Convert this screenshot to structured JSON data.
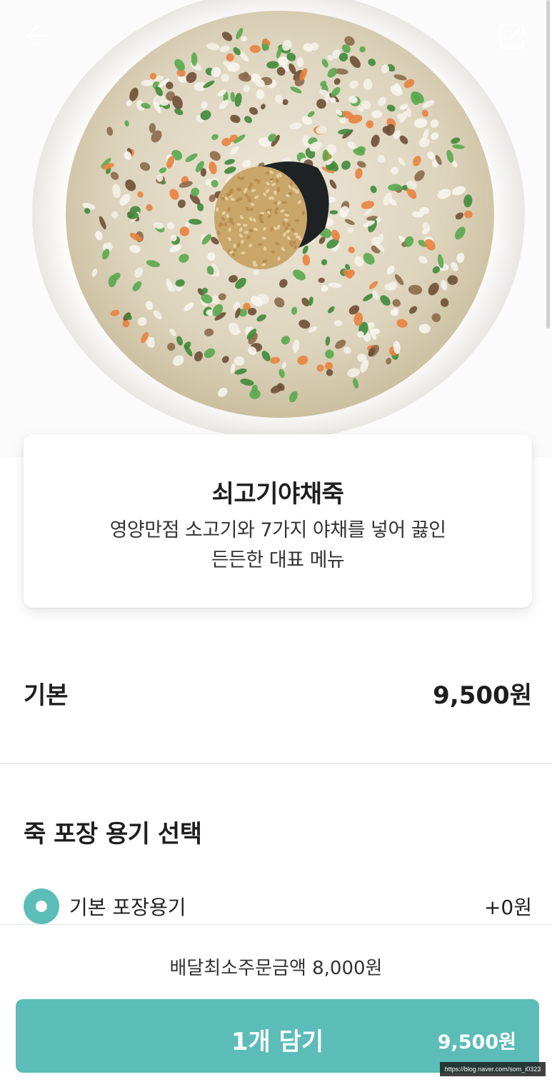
{
  "menu": {
    "title": "쇠고기야채죽",
    "description_line1": "영양만점 소고기와 7가지 야채를 넣어 끓인",
    "description_line2": "든든한 대표 메뉴"
  },
  "base": {
    "label": "기본",
    "price": "9,500원"
  },
  "packaging": {
    "title": "죽 포장 용기 선택",
    "options": [
      {
        "label": "기본 포장용기",
        "price": "+0원",
        "selected": true
      }
    ]
  },
  "order": {
    "min_order_text": "배달최소주문금액 8,000원",
    "button_label": "1개 담기",
    "button_price": "9,500원"
  },
  "watermark": "https://blog.naver.com/som_i0323",
  "icons": {
    "back": "arrow-left-icon",
    "share": "share-icon",
    "radio": "radio-selected-icon"
  },
  "colors": {
    "accent": "#5bbcb8",
    "text": "#1e1e1e",
    "divider": "#ececec"
  }
}
